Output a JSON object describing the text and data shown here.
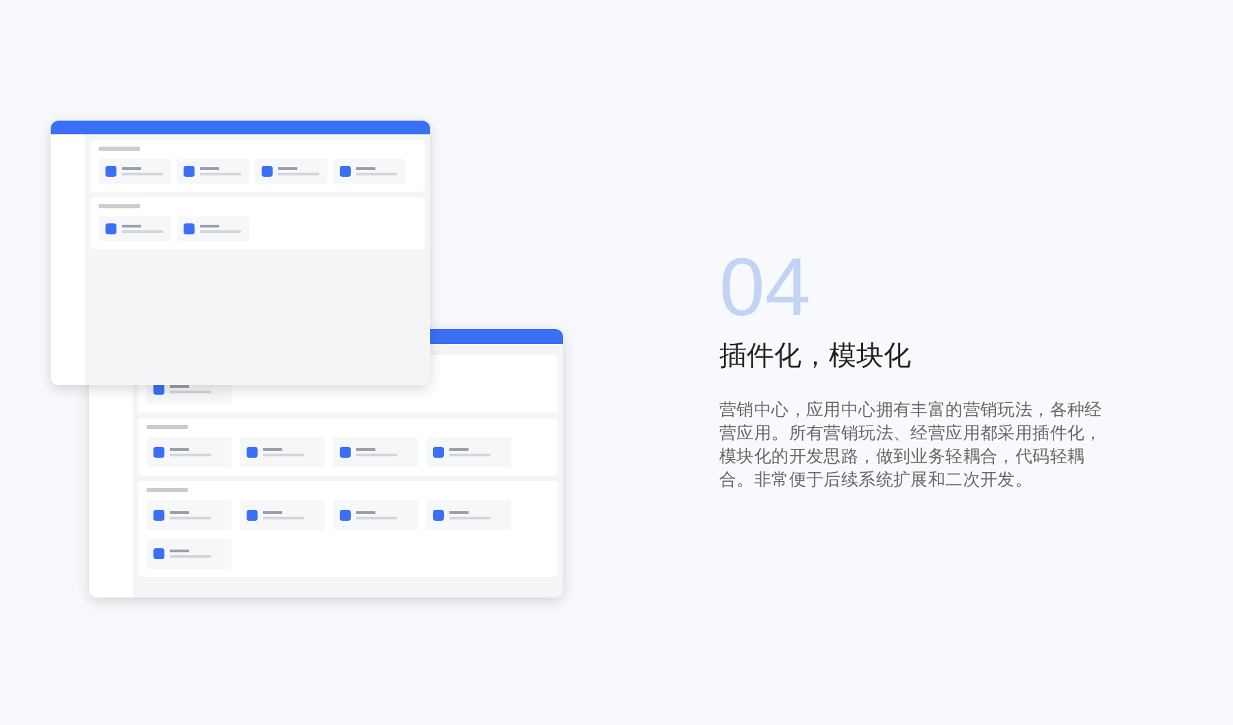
{
  "feature": {
    "number": "04",
    "title": "插件化，模块化",
    "description": "营销中心，应用中心拥有丰富的营销玩法，各种经营应用。所有营销玩法、经营应用都采用插件化，模块化的开发思路，做到业务轻耦合，代码轻耦合。非常便于后续系统扩展和二次开发。"
  }
}
